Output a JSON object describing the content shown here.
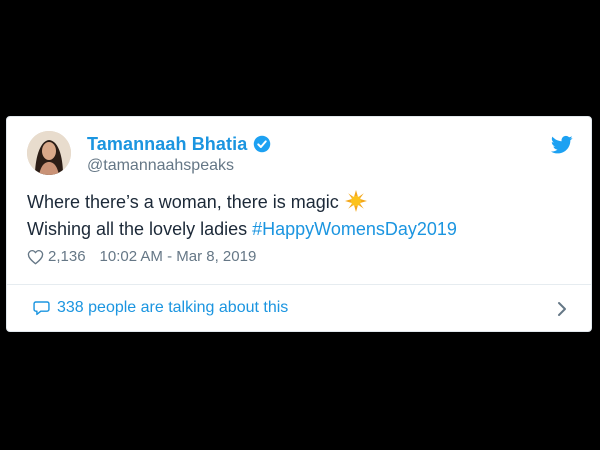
{
  "tweet": {
    "display_name": "Tamannaah Bhatia",
    "handle": "@tamannaahspeaks",
    "line1": "Where there’s a woman, there is magic",
    "line2_prefix": "Wishing all the lovely ladies ",
    "hashtag": "#HappyWomensDay2019",
    "likes": "2,136",
    "timestamp": "10:02 AM - Mar 8, 2019",
    "talking": "338 people are talking about this"
  },
  "colors": {
    "accent": "#1b95e0",
    "text": "#1c2938",
    "muted": "#657786",
    "background": "#000000",
    "card": "#ffffff"
  },
  "icons": [
    "verified-badge-icon",
    "twitter-bird-icon",
    "sun-emoji-icon",
    "heart-icon",
    "speech-bubble-icon",
    "chevron-right-icon"
  ]
}
